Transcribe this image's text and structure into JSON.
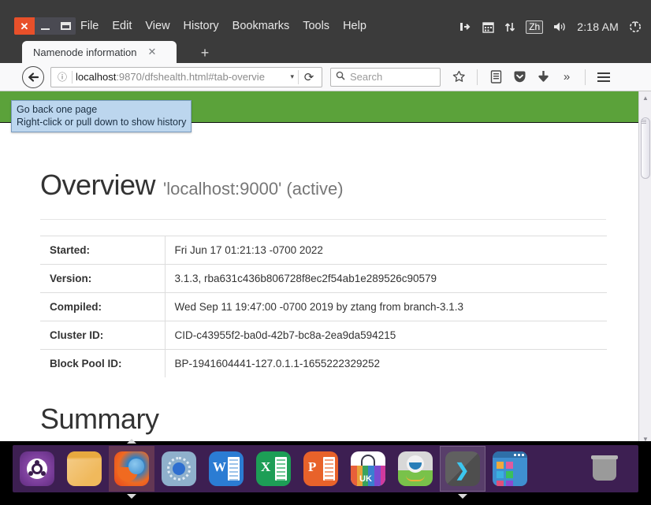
{
  "window": {
    "controls": {
      "close": "✕",
      "minimize": "—",
      "maximize": "▭"
    },
    "menu": [
      "File",
      "Edit",
      "View",
      "History",
      "Bookmarks",
      "Tools",
      "Help"
    ]
  },
  "tray": {
    "network_icon": "network-icon",
    "calendar_icon": "calendar-icon",
    "transfer_icon": "transfer-icon",
    "input_method": "Zh",
    "volume_icon": "volume-icon",
    "clock": "2:18 AM",
    "power_icon": "power-icon"
  },
  "browser": {
    "tab": {
      "title": "Namenode information",
      "close": "✕"
    },
    "new_tab": "+",
    "back_icon": "back-arrow-icon",
    "info_icon": "ⓘ",
    "url_prefix": "localhost",
    "url_rest": ":9870/dfshealth.html#tab-overvie",
    "url_dropdown": "▾",
    "reload_icon": "⟳",
    "search_placeholder": "Search",
    "search_icon": "search-icon",
    "toolbar_icons": [
      "star-icon",
      "library-icon",
      "pocket-icon",
      "download-icon",
      "overflow-icon",
      "menu-icon"
    ],
    "overflow_glyph": "»"
  },
  "tooltip": {
    "line1": "Go back one page",
    "line2": "Right-click or pull down to show history"
  },
  "page": {
    "navbar_color": "#5ba23a",
    "heading": "Overview",
    "heading_suffix": "'localhost:9000' (active)",
    "table": [
      {
        "key": "Started:",
        "value": "Fri Jun 17 01:21:13 -0700 2022"
      },
      {
        "key": "Version:",
        "value": "3.1.3, rba631c436b806728f8ec2f54ab1e289526c90579"
      },
      {
        "key": "Compiled:",
        "value": "Wed Sep 11 19:47:00 -0700 2019 by ztang from branch-3.1.3"
      },
      {
        "key": "Cluster ID:",
        "value": "CID-c43955f2-ba0d-42b7-bc8a-2ea9da594215"
      },
      {
        "key": "Block Pool ID:",
        "value": "BP-1941604441-127.0.1.1-1655222329252"
      }
    ],
    "summary_heading": "Summary"
  },
  "scrollbar": {
    "up": "▲",
    "down": "▼"
  },
  "dock": {
    "items": [
      {
        "name": "ubuntu-launcher",
        "label": "Ubuntu"
      },
      {
        "name": "files",
        "label": "Files"
      },
      {
        "name": "firefox",
        "label": "Firefox",
        "running": true
      },
      {
        "name": "chromium",
        "label": "Chromium"
      },
      {
        "name": "word",
        "label": "Word",
        "glyph": "W"
      },
      {
        "name": "excel",
        "label": "Excel",
        "glyph": "X"
      },
      {
        "name": "powerpoint",
        "label": "PowerPoint",
        "glyph": "P"
      },
      {
        "name": "ubuntu-software",
        "label": "Ubuntu Software",
        "glyph": "UK"
      },
      {
        "name": "amazon",
        "label": "Amazon"
      },
      {
        "name": "terminal",
        "label": "Terminal",
        "glyph": "❯",
        "running": true
      },
      {
        "name": "show-applications",
        "label": "Show Applications"
      },
      {
        "name": "trash",
        "label": "Trash"
      }
    ]
  }
}
